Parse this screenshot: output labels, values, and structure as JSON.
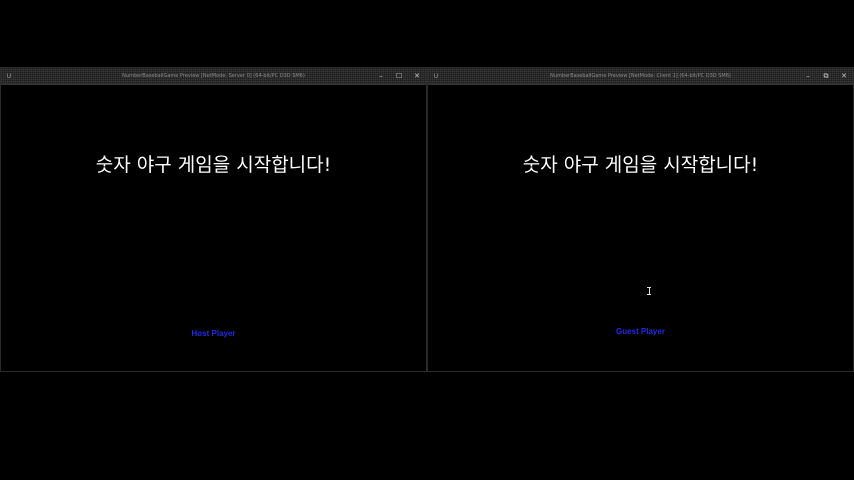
{
  "left_window": {
    "title": "NumberBaseballGame Preview [NetMode: Server 0]  (64-bit/PC D3D SM6)",
    "app_icon": "U",
    "controls": {
      "minimize": "–",
      "maximize": "☐",
      "close": "✕"
    },
    "heading": "숫자 야구 게임을 시작합니다!",
    "role_label": "Host Player"
  },
  "right_window": {
    "title": "NumberBaseballGame Preview [NetMode: Client 1]  (64-bit/PC D3D SM6)",
    "app_icon": "U",
    "controls": {
      "minimize": "–",
      "maximize": "⧉",
      "close": "✕"
    },
    "heading": "숫자 야구 게임을 시작합니다!",
    "role_label": "Guest Player"
  },
  "colors": {
    "background": "#000000",
    "heading_text": "#ffffff",
    "role_label": "#1f2be8"
  },
  "icons": {
    "app": "unreal-engine-icon",
    "cursor": "text-cursor-icon"
  }
}
